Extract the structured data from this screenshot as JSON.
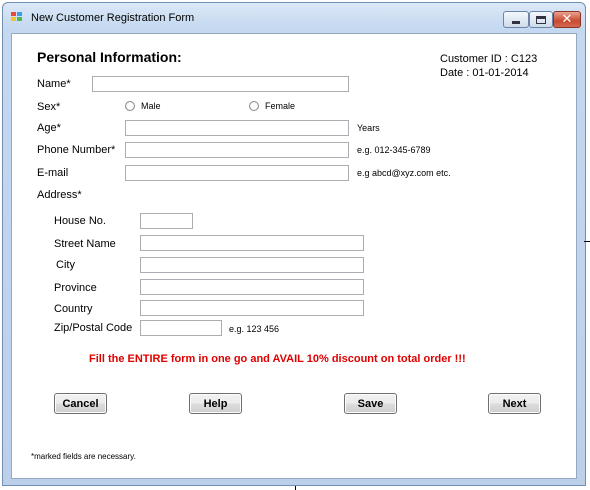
{
  "window": {
    "title": "New Customer Registration Form"
  },
  "form": {
    "heading": "Personal Information:",
    "customer_id": "Customer ID : C123",
    "date": "Date : 01-01-2014",
    "name_label": "Name*",
    "name_value": "",
    "sex_label": "Sex*",
    "sex_options": [
      "Male",
      "Female"
    ],
    "age_label": "Age*",
    "age_value": "",
    "age_hint": "Years",
    "phone_label": "Phone Number*",
    "phone_value": "",
    "phone_hint": "e.g. 012-345-6789",
    "email_label": "E-mail",
    "email_value": "",
    "email_hint": "e.g abcd@xyz.com etc.",
    "address_label": "Address*",
    "address": {
      "house_label": "House No.",
      "house_value": "",
      "street_label": "Street Name",
      "street_value": "",
      "city_label": "City",
      "city_value": "",
      "province_label": "Province",
      "province_value": "",
      "country_label": "Country",
      "country_value": "",
      "zip_label": "Zip/Postal Code",
      "zip_value": "",
      "zip_hint": "e.g. 123 456"
    },
    "promo": "Fill the ENTIRE form in one go and AVAIL 10% discount on total order !!!",
    "buttons": {
      "cancel": "Cancel",
      "help": "Help",
      "save": "Save",
      "next": "Next"
    },
    "footnote": "*marked fields are necessary."
  },
  "colors": {
    "promo": "#e00000",
    "title_bar": "#c4d8f0",
    "close_button": "#c74a31"
  }
}
